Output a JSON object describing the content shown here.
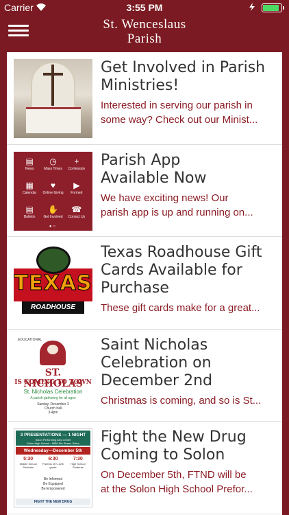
{
  "status_bar": {
    "carrier": "Carrier",
    "time": "3:55 PM",
    "battery_level": 0.9
  },
  "nav": {
    "title_line1": "St. Wenceslaus",
    "title_line2": "Parish"
  },
  "news": [
    {
      "title_lines": [
        "Get Involved in Parish",
        "Ministries!"
      ],
      "desc_lines": [
        "Interested in serving our parish in",
        "some way? Check out our Minist..."
      ]
    },
    {
      "title_lines": [
        "Parish App",
        "Available Now"
      ],
      "desc_lines": [
        "We have exciting news! Our",
        "parish app is up and running on..."
      ]
    },
    {
      "title_lines": [
        "Texas Roadhouse Gift",
        "Cards Available for",
        "Purchase"
      ],
      "desc_lines": [
        "These gift cards make for a great..."
      ]
    },
    {
      "title_lines": [
        "Saint Nicholas",
        "Celebration on",
        "December 2nd"
      ],
      "desc_lines": [
        "Christmas is coming, and so is St..."
      ]
    },
    {
      "title_lines": [
        "Fight the New Drug",
        "Coming to Solon"
      ],
      "desc_lines": [
        "On December 5th, FTND will be",
        "at the Solon High School Prefor..."
      ]
    }
  ],
  "thumb_app": {
    "items": [
      "News",
      "Mass Times",
      "Confession",
      "Calendar",
      "Online Giving",
      "Formed",
      "Bulletin",
      "Get Involved",
      "Contact Us"
    ],
    "icons": [
      "newspaper-icon",
      "clock-icon",
      "plus-icon",
      "calendar-icon",
      "giving-icon",
      "play-icon",
      "bulletin-icon",
      "hand-icon",
      "phone-icon"
    ]
  },
  "thumb_texas": {
    "word": "TEXAS",
    "sub": "ROADHOUSE"
  },
  "thumb_nicholas": {
    "small": "EDUCATIONAL",
    "heading": "ST. NICHOLAS",
    "heading2": "IS COMING TO TOWN",
    "subtitle": "St. Nicholas Celebration",
    "tagline": "A parish gathering for all ages",
    "date": "Sunday, December 2",
    "place": "Church hall",
    "time": "3-4pm"
  },
  "thumb_ftnd": {
    "header": "3 PRESENTATIONS — 1 NIGHT",
    "venue": "Solon Performing Arts Center",
    "address": "Solon High School · 6556 Sth Street, Solon",
    "date": "Wednesday—December 5th",
    "times": [
      {
        "time": "5:30",
        "who": "Middle School Students"
      },
      {
        "time": "6:30",
        "who": "Parents of K-12th grade"
      },
      {
        "time": "7:30",
        "who": "High School Students"
      }
    ],
    "be_lines": [
      "Be Informed",
      "Be Equipped",
      "Be Empowered"
    ],
    "footer": "FIGHT THE NEW DRUG"
  },
  "colors": {
    "brand": "#7b1a22",
    "accent_text": "#8b1c24",
    "battery": "#4cd964"
  }
}
